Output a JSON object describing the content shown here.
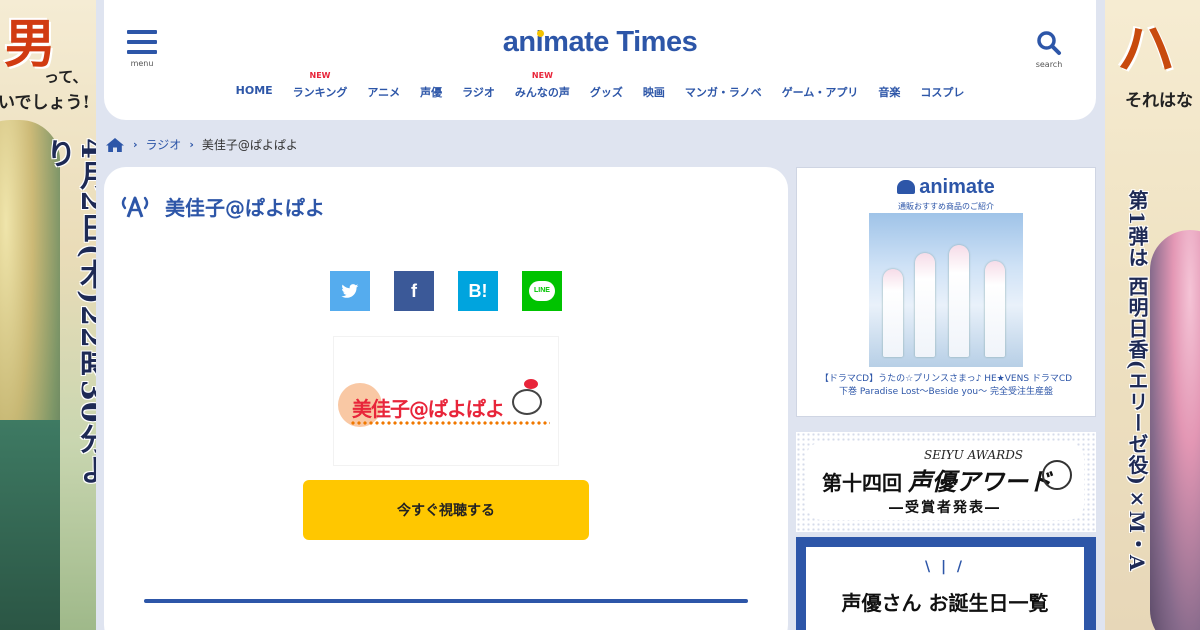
{
  "ads": {
    "left": {
      "big": "男",
      "tail_a": "って、",
      "tail_b": "いでしょう!",
      "date": "4月2日(木)22時30分より"
    },
    "right": {
      "big": "ハ",
      "tail": "それはな",
      "cast": "第1弾は 西明日香(エリーゼ役)×M・A"
    }
  },
  "header": {
    "menu_label": "menu",
    "search_label": "search",
    "logo_pre": "an",
    "logo_i": "i",
    "logo_post": "mate Times",
    "nav": [
      {
        "label": "HOME",
        "badge": ""
      },
      {
        "label": "ランキング",
        "badge": "NEW"
      },
      {
        "label": "アニメ",
        "badge": ""
      },
      {
        "label": "声優",
        "badge": ""
      },
      {
        "label": "ラジオ",
        "badge": ""
      },
      {
        "label": "みんなの声",
        "badge": "NEW"
      },
      {
        "label": "グッズ",
        "badge": ""
      },
      {
        "label": "映画",
        "badge": ""
      },
      {
        "label": "マンガ・ラノベ",
        "badge": ""
      },
      {
        "label": "ゲーム・アプリ",
        "badge": ""
      },
      {
        "label": "音楽",
        "badge": ""
      },
      {
        "label": "コスプレ",
        "badge": ""
      }
    ]
  },
  "breadcrumb": {
    "section": "ラジオ",
    "current": "美佳子@ぱよぱよ"
  },
  "article": {
    "title": "美佳子@ぱよぱよ",
    "share": {
      "hatena": "B!",
      "line": "LINE",
      "facebook": "f"
    },
    "thumbnail_text": "美佳子@ぱよぱよ",
    "listen_label": "今すぐ視聴する"
  },
  "sidebar": {
    "product_ad": {
      "logo": "animate",
      "subtitle": "通販おすすめ商品のご紹介",
      "caption": "【ドラマCD】うたの☆プリンスさまっ♪ HE★VENS ドラマCD 下巻 Paradise Lost～Beside you～ 完全受注生産盤"
    },
    "award": {
      "en": "SEIYU AWARDS",
      "prefix": "第十四回",
      "title": "声優アワード",
      "subtitle": "―受賞者発表―"
    },
    "birthday": {
      "ticks": "\\ | /",
      "title": "声優さん お誕生日一覧"
    }
  },
  "colors": {
    "brand": "#2d56a8",
    "accent": "#ffc700",
    "new_badge": "#e8253a"
  }
}
